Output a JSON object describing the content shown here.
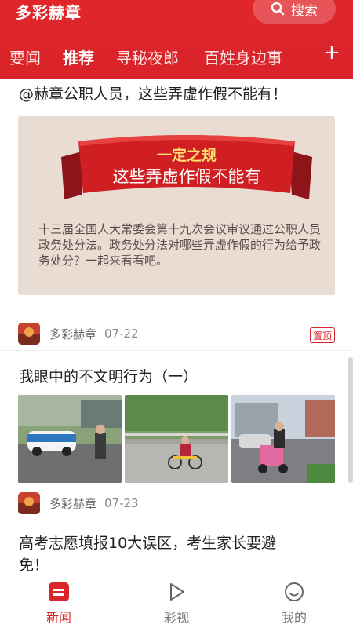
{
  "header": {
    "app_title": "多彩赫章",
    "search_label": "搜索",
    "tabs": [
      "要闻",
      "推荐",
      "寻秘夜郎",
      "百姓身边事"
    ],
    "active_tab": "推荐",
    "add_icon": "plus-icon"
  },
  "articles": [
    {
      "title": "@赫章公职人员，这些弄虚作假不能有！",
      "hero_banner_line1": "一定之规",
      "hero_banner_line2": "这些弄虚作假不能有",
      "hero_text": "十三届全国人大常委会第十九次会议审议通过公职人员政务处分法。政务处分法对哪些弄虚作假的行为给予政务处分？一起来看看吧。",
      "source": "多彩赫章",
      "date": "07-22",
      "badge": "置顶"
    },
    {
      "title": "我眼中的不文明行为（一）",
      "source": "多彩赫章",
      "date": "07-23"
    },
    {
      "title_line1": "高考志愿填报10大误区，考生家长要避",
      "title_line2": "免！"
    }
  ],
  "bottom_nav": {
    "items": [
      {
        "label": "新闻",
        "icon": "news-icon",
        "active": true
      },
      {
        "label": "彩视",
        "icon": "play-icon",
        "active": false
      },
      {
        "label": "我的",
        "icon": "smile-icon",
        "active": false
      }
    ]
  },
  "colors": {
    "brand_red": "#d9242a",
    "tab_inactive": "#fde3e3"
  }
}
